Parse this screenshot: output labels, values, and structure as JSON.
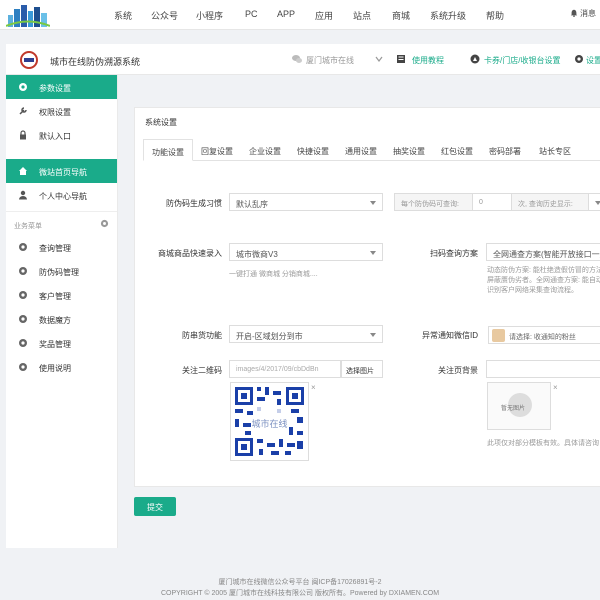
{
  "topnav": {
    "items": [
      "系统",
      "公众号",
      "小程序",
      "PC",
      "APP",
      "应用",
      "站点",
      "商城",
      "系统升级",
      "帮助"
    ],
    "message_label": "消息"
  },
  "sysbar": {
    "title": "城市在线防伪溯源系统",
    "site_name": "厦门城市在线",
    "tutorial": "使用教程",
    "shop_link": "卡券/门店/收银台设置",
    "settings": "设置"
  },
  "sidebar": {
    "items": [
      {
        "label": "参数设置",
        "icon": "gear-icon",
        "active": true
      },
      {
        "label": "权限设置",
        "icon": "wrench-icon",
        "active": false
      },
      {
        "label": "默认入口",
        "icon": "lock-icon",
        "active": false
      },
      {
        "label": "微站首页导航",
        "icon": "home-icon",
        "active": true
      },
      {
        "label": "个人中心导航",
        "icon": "user-icon",
        "active": false
      }
    ],
    "group_label": "业务菜单",
    "business": [
      {
        "label": "查询管理",
        "icon": "gear-icon"
      },
      {
        "label": "防伪码管理",
        "icon": "gear-icon"
      },
      {
        "label": "客户管理",
        "icon": "gear-icon"
      },
      {
        "label": "数据魔方",
        "icon": "gear-icon"
      },
      {
        "label": "奖品管理",
        "icon": "gear-icon"
      },
      {
        "label": "使用说明",
        "icon": "gear-icon"
      }
    ]
  },
  "panel": {
    "title": "系统设置",
    "tabs": [
      "功能设置",
      "回复设置",
      "企业设置",
      "快捷设置",
      "通用设置",
      "抽奖设置",
      "红包设置",
      "密码部署",
      "站长专区"
    ]
  },
  "form": {
    "code_gen_label": "防伪码生成习惯",
    "code_gen_value": "默认乱序",
    "per_code_label": "每个防伪码可查询:",
    "per_code_value": "0",
    "history_label": "次, 查询历史显示:",
    "mall_label": "商城商品快速录入",
    "mall_value": "城市微商V3",
    "mall_hint": "一键打通 微商城 分销商城....",
    "scan_label": "扫码查询方案",
    "scan_value": "全网通查方案(智能开放接口一刷",
    "scan_hint": "动态防伪方案: 能杜绝造假仿冒的方法屏蔽赝伪劣者。全网通查方案: 能自动识别客户网络采集查询流程。",
    "anti_label": "防串货功能",
    "anti_value": "开启-区域划分到市",
    "notify_label": "异常通知微信ID",
    "notify_value": "请选择: 收通知的粉丝",
    "qr_label": "关注二维码",
    "qr_path": "images/4/2017/09/cbDdBn",
    "pick_image": "选择图片",
    "qr_overlay": "城市在线",
    "bg_label": "关注页背景",
    "bg_placeholder": "暂无图片",
    "bg_hint": "此项仅对部分模板有效。具体请咨询"
  },
  "submit_label": "提交",
  "footer": {
    "line1": "厦门城市在线微信公众号平台 闽ICP备17026891号-2",
    "line2": "COPYRIGHT © 2005 厦门城市在线科技有限公司 版权所有。Powered by DXIAMEN.COM"
  },
  "colors": {
    "accent": "#1aab8a"
  }
}
